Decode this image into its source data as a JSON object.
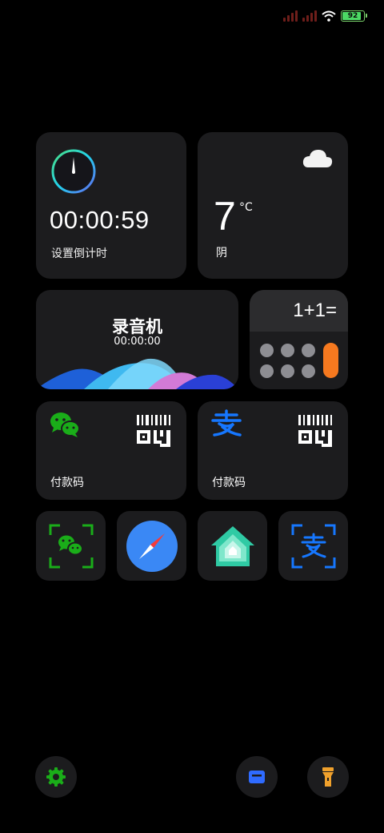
{
  "status_bar": {
    "battery_level": "92",
    "battery_fraction": 0.92,
    "signal_icon": "signal-icon",
    "wifi_icon": "wifi-icon"
  },
  "timer": {
    "time": "00:00:59",
    "label": "设置倒计时"
  },
  "weather": {
    "temperature": "7",
    "unit": "°C",
    "condition": "阴",
    "icon": "cloud-icon"
  },
  "recorder": {
    "title": "录音机",
    "time": "00:00:00"
  },
  "calculator": {
    "display": "1+1="
  },
  "wechat_pay": {
    "label": "付款码",
    "icon": "wechat-icon"
  },
  "alipay": {
    "label": "付款码",
    "icon": "alipay-icon"
  },
  "apps": [
    {
      "name": "wechat-scan"
    },
    {
      "name": "compass"
    },
    {
      "name": "smart-home"
    },
    {
      "name": "alipay-scan"
    }
  ],
  "colors": {
    "wechat_green": "#1aad19",
    "alipay_blue": "#1677ff",
    "calc_orange": "#f6791f",
    "card_bg": "#1c1c1e"
  }
}
